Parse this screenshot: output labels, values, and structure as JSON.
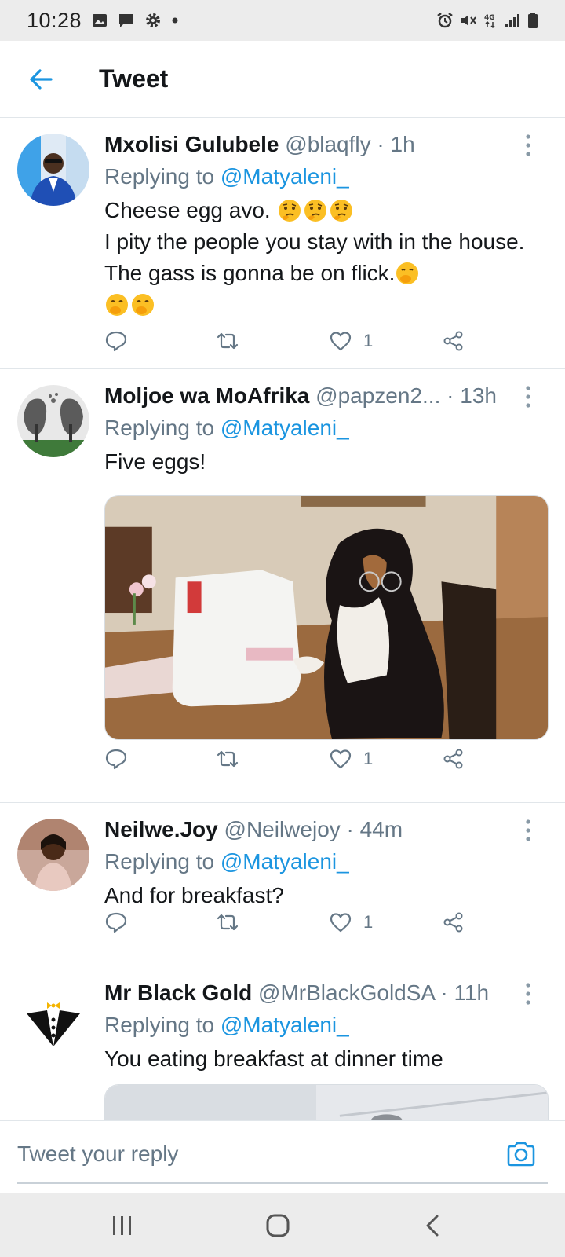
{
  "status_bar": {
    "time": "10:28",
    "network": "4G"
  },
  "header": {
    "title": "Tweet"
  },
  "tweets": [
    {
      "name": "Mxolisi Gulubele",
      "handle": "@blaqfly",
      "time": "1h",
      "replying_prefix": "Replying to ",
      "replying_to": "@Matyaleni_",
      "text_line1": "Cheese egg avo.",
      "text_line2": "I pity the people you stay with in the house. The gass is gonna be on flick.",
      "likes": "1"
    },
    {
      "name": "Moljoe wa MoAfrika",
      "handle": "@papzen2...",
      "time": "13h",
      "replying_prefix": "Replying to ",
      "replying_to": "@Matyaleni_",
      "text_line1": "Five eggs!",
      "likes": "1"
    },
    {
      "name": "Neilwe.Joy",
      "handle": "@Neilwejoy",
      "time": "44m",
      "replying_prefix": "Replying to ",
      "replying_to": "@Matyaleni_",
      "text_line1": "And for breakfast?",
      "likes": "1"
    },
    {
      "name": "Mr Black Gold",
      "handle": "@MrBlackGoldSA",
      "time": "11h",
      "replying_prefix": "Replying to ",
      "replying_to": "@Matyaleni_",
      "text_line1": "You eating breakfast at dinner time"
    }
  ],
  "dot_separator": "·",
  "reply_bar": {
    "placeholder": "Tweet your reply"
  },
  "colors": {
    "accent": "#1b95e0",
    "secondary_text": "#657786",
    "divider": "#e1e6ea"
  },
  "icons": {
    "back": "arrow-left-icon",
    "more": "more-vertical-icon",
    "reply": "comment-icon",
    "retweet": "retweet-icon",
    "like": "heart-icon",
    "share": "share-icon",
    "camera": "camera-icon"
  }
}
